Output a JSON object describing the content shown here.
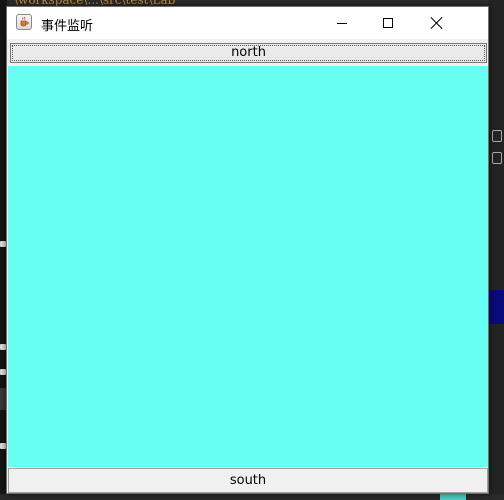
{
  "window": {
    "title": "事件监听",
    "app_icon": "java-cup-icon",
    "controls": {
      "minimize_icon": "minimize-icon",
      "maximize_icon": "maximize-icon",
      "close_icon": "close-icon"
    }
  },
  "north_button": {
    "label": "north"
  },
  "center_panel": {
    "color": "#66fff2"
  },
  "south_button": {
    "label": "south"
  }
}
